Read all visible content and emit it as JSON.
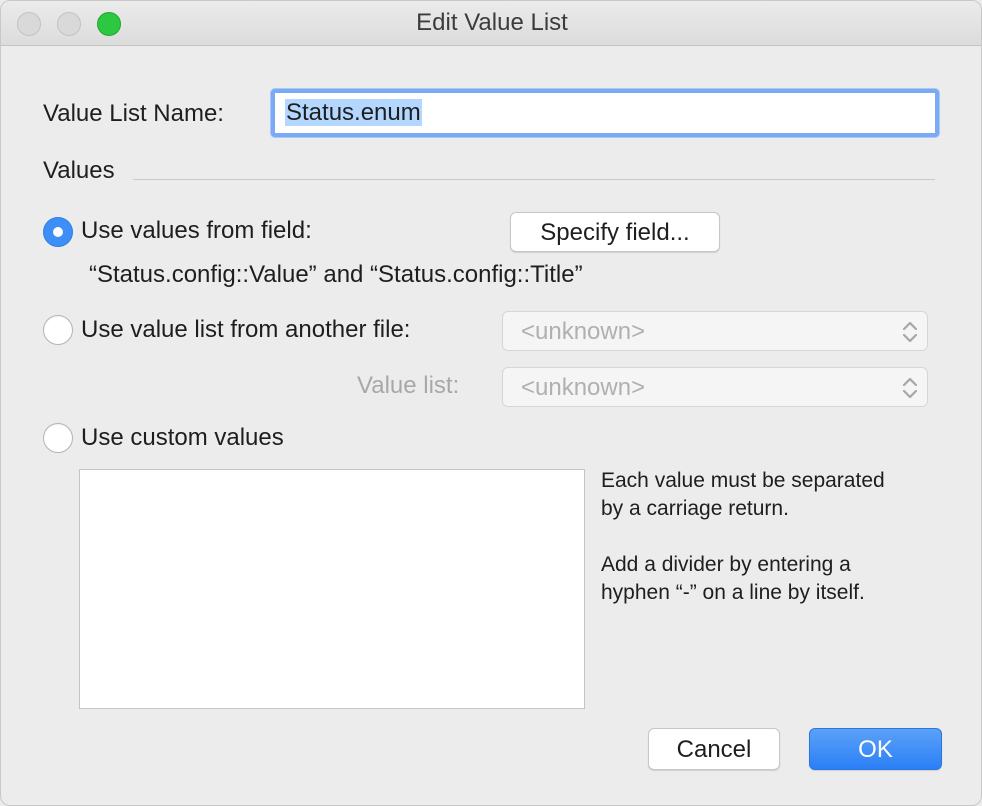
{
  "window": {
    "title": "Edit Value List"
  },
  "form": {
    "name_label": "Value List Name:",
    "name_value": "Status.enum",
    "section_title": "Values"
  },
  "options": {
    "field": {
      "label": "Use values from field:",
      "selected": true,
      "button_label": "Specify field...",
      "field_description": "“Status.config::Value” and “Status.config::Title”"
    },
    "file": {
      "label": "Use value list from another file:",
      "selected": false,
      "file_popup_value": "<unknown>",
      "list_label": "Value list:",
      "list_popup_value": "<unknown>"
    },
    "custom": {
      "label": "Use custom values",
      "selected": false,
      "value": "",
      "hint_line1": "Each value must be separated",
      "hint_line2": "by a carriage return.",
      "hint_line3": "Add a divider by entering a",
      "hint_line4": "hyphen “-” on a line by itself."
    }
  },
  "buttons": {
    "cancel": "Cancel",
    "ok": "OK"
  },
  "colors": {
    "accent": "#3d8ff7",
    "focus_ring": "#7aaaf3",
    "selection": "#b3d7ff",
    "maximize": "#2bc840"
  },
  "icons": {
    "popup_indicator": "up-down-chevron-icon"
  }
}
